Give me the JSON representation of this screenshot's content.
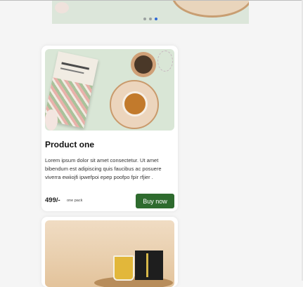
{
  "carousel": {
    "active_slide": 3,
    "slide_count": 3
  },
  "products": [
    {
      "title": "Product one",
      "description": "Lorem ipsum dolor sit amet consectetur. Ut amet bibendum est adipiscing quis faucibus ac posuere viverra ewiiojfi ipwefpoi epep poofpo fpir rfjier .",
      "price": "499/-",
      "pack": "one pack",
      "buy_label": "Buy now"
    }
  ]
}
